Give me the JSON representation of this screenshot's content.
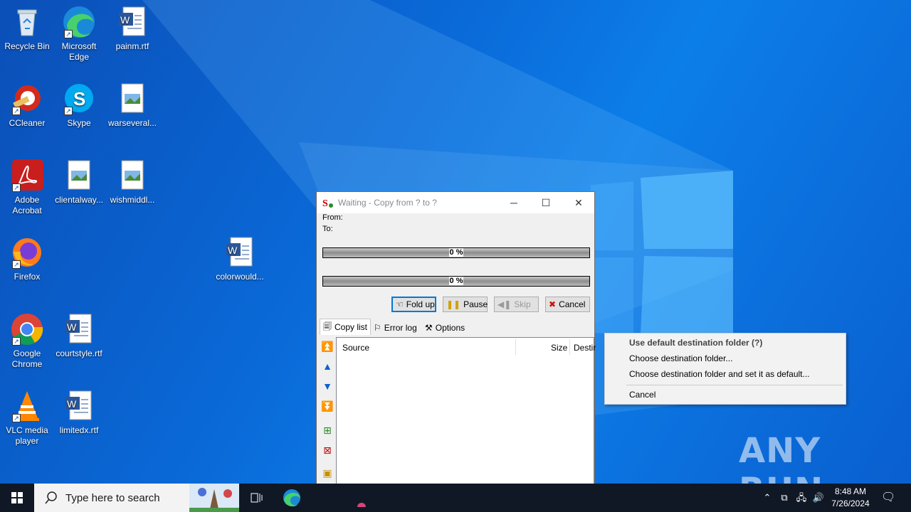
{
  "desktop_icons": [
    {
      "label": "Recycle Bin",
      "icon": "recycle-bin-icon"
    },
    {
      "label": "Microsoft Edge",
      "icon": "edge-icon"
    },
    {
      "label": "painm.rtf",
      "icon": "word-doc-icon"
    },
    {
      "label": "CCleaner",
      "icon": "ccleaner-icon"
    },
    {
      "label": "Skype",
      "icon": "skype-icon"
    },
    {
      "label": "warseveral...",
      "icon": "image-file-icon"
    },
    {
      "label": "Adobe Acrobat",
      "icon": "acrobat-icon"
    },
    {
      "label": "clientalway...",
      "icon": "image-file-icon"
    },
    {
      "label": "wishmiddl...",
      "icon": "image-file-icon"
    },
    {
      "label": "colorwould...",
      "icon": "word-doc-icon"
    },
    {
      "label": "Firefox",
      "icon": "firefox-icon"
    },
    {
      "label": "Google Chrome",
      "icon": "chrome-icon"
    },
    {
      "label": "courtstyle.rtf",
      "icon": "word-doc-icon"
    },
    {
      "label": "VLC media player",
      "icon": "vlc-icon"
    },
    {
      "label": "limitedx.rtf",
      "icon": "word-doc-icon"
    }
  ],
  "copy_window": {
    "title": "Waiting - Copy from ? to ?",
    "from_label": "From:",
    "to_label": "To:",
    "progress_current": "0 %",
    "progress_total": "0 %",
    "buttons": {
      "fold_up": "Fold up",
      "pause": "Pause",
      "skip": "Skip",
      "cancel": "Cancel"
    },
    "tabs": {
      "copy_list": "Copy list",
      "error_log": "Error log",
      "options": "Options"
    },
    "columns": {
      "source": "Source",
      "size": "Size",
      "destination": "Destir"
    }
  },
  "context_menu": {
    "items": [
      "Use default destination folder (?)",
      "Choose destination folder...",
      "Choose destination folder and set it as default...",
      "Cancel"
    ]
  },
  "taskbar": {
    "search_placeholder": "Type here to search",
    "time": "8:48 AM",
    "date": "7/26/2024"
  },
  "watermark": "ANY RUN"
}
